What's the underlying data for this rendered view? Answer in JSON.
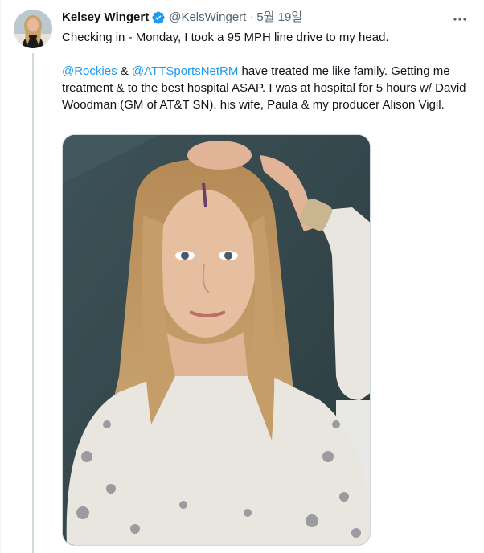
{
  "tweet": {
    "display_name": "Kelsey Wingert",
    "handle": "@KelsWingert",
    "separator": "·",
    "timestamp": "5월 19일",
    "line1": "Checking in - Monday, I took a 95 MPH line drive to my head.",
    "p2_mention1": "@Rockies",
    "p2_amp": " & ",
    "p2_mention2": "@ATTSportsNetRM",
    "p2_rest": " have treated me like family. Getting me treatment & to the best hospital ASAP. I was at hospital for 5 hours w/ David Woodman (GM of AT&T SN), his wife, Paula & my producer Alison Vigil."
  },
  "icons": {
    "verified": "verified-badge-icon",
    "more": "more-options-icon"
  },
  "colors": {
    "link": "#1d9bf0",
    "secondary_text": "#536471",
    "primary_text": "#0f1419",
    "thread_line": "#cfd9de"
  }
}
